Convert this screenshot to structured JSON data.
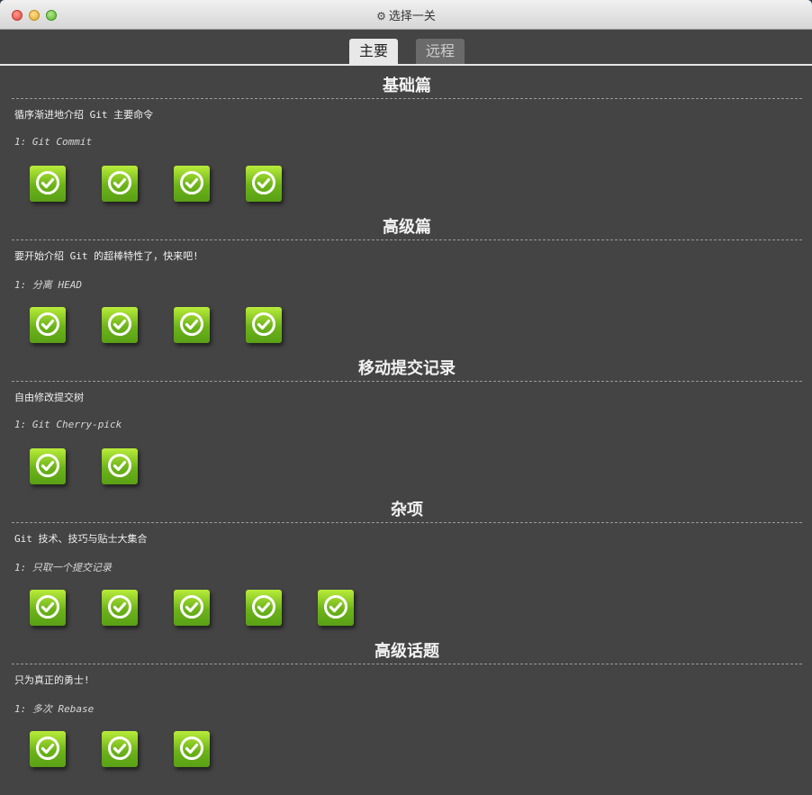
{
  "window": {
    "title": "选择一关",
    "title_icon": "gear-icon"
  },
  "tabs": [
    {
      "label": "主要",
      "active": true
    },
    {
      "label": "远程",
      "active": false
    }
  ],
  "sections": [
    {
      "title": "基础篇",
      "description": "循序渐进地介绍 Git 主要命令",
      "subtitle": "1: Git Commit",
      "levels": 4,
      "completed": true
    },
    {
      "title": "高级篇",
      "description": "要开始介绍 Git 的超棒特性了，快来吧!",
      "subtitle": "1: 分离 HEAD",
      "levels": 4,
      "completed": true
    },
    {
      "title": "移动提交记录",
      "description": "自由修改提交树",
      "subtitle": "1: Git Cherry-pick",
      "levels": 2,
      "completed": true
    },
    {
      "title": "杂项",
      "description": "Git 技术、技巧与贴士大集合",
      "subtitle": "1: 只取一个提交记录",
      "levels": 5,
      "completed": true
    },
    {
      "title": "高级话题",
      "description": "只为真正的勇士!",
      "subtitle": "1: 多次 Rebase",
      "levels": 3,
      "completed": true
    }
  ],
  "colors": {
    "background": "#444444",
    "level_complete": "#7cc11e",
    "tab_active": "#e8e8e8",
    "tab_inactive": "#6a6a6a"
  }
}
